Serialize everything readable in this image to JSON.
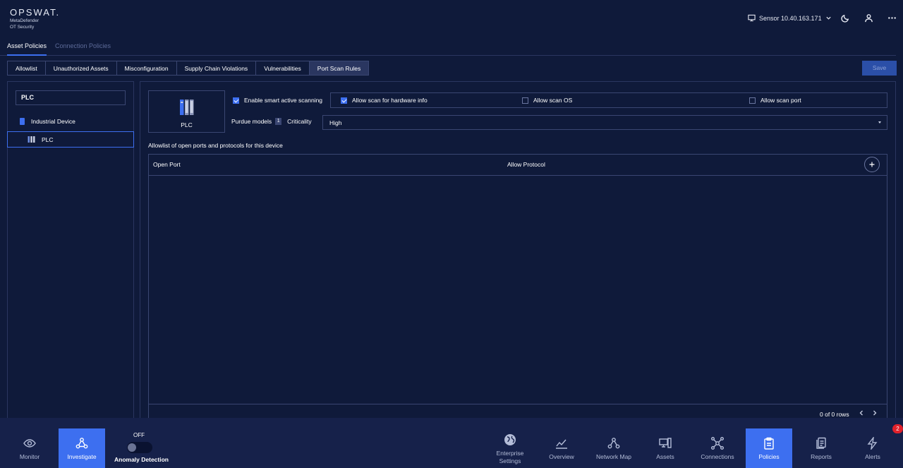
{
  "header": {
    "logo_main": "OPSWAT.",
    "logo_sub1": "MetaDefender",
    "logo_sub2": "OT Security",
    "sensor_label": "Sensor 10.40.163.171"
  },
  "policy_tabs": [
    {
      "label": "Asset Policies",
      "active": true
    },
    {
      "label": "Connection Policies",
      "active": false
    }
  ],
  "sub_tabs": [
    {
      "label": "Allowlist"
    },
    {
      "label": "Unauthorized Assets"
    },
    {
      "label": "Misconfiguration"
    },
    {
      "label": "Supply Chain Violations"
    },
    {
      "label": "Vulnerabilities"
    },
    {
      "label": "Port Scan Rules",
      "active": true
    }
  ],
  "save_label": "Save",
  "left": {
    "search_value": "PLC",
    "tree": [
      {
        "label": "Industrial Device"
      },
      {
        "label": "PLC",
        "selected": true
      }
    ]
  },
  "device": {
    "name": "PLC",
    "enable_smart_scan": {
      "label": "Enable smart active scanning",
      "checked": true
    },
    "scan_options": [
      {
        "label": "Allow scan for hardware info",
        "checked": true
      },
      {
        "label": "Allow scan OS",
        "checked": false
      },
      {
        "label": "Allow scan port",
        "checked": false
      }
    ],
    "purdue_label": "Purdue models",
    "purdue_value": "1",
    "criticality_label": "Criticality",
    "criticality_value": "High"
  },
  "table": {
    "caption": "Allowlist of open ports and protocols for this device",
    "columns": [
      "Open Port",
      "Allow Protocol"
    ],
    "rows_info": "0 of 0 rows"
  },
  "bottom_nav": {
    "monitor": "Monitor",
    "investigate": "Investigate",
    "toggle_state": "OFF",
    "anomaly": "Anomaly Detection",
    "enterprise_1": "Enterprise",
    "enterprise_2": "Settings",
    "overview": "Overview",
    "network_map": "Network Map",
    "assets": "Assets",
    "connections": "Connections",
    "policies": "Policies",
    "reports": "Reports",
    "alerts": "Alerts",
    "alerts_count": "2"
  },
  "colors": {
    "background": "#0f1a3a",
    "accent": "#3d6ff0",
    "alert": "#e0212b"
  }
}
